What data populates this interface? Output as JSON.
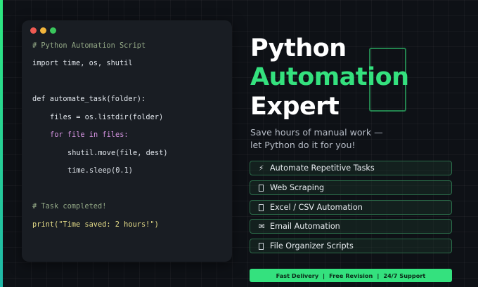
{
  "colors": {
    "accent_green": "#34e17e",
    "background": "#0e1116",
    "code_panel": "#191d23",
    "dot_red": "#ee5a52",
    "dot_yellow": "#f2b53c",
    "dot_green": "#3ac65c"
  },
  "code": {
    "lines": [
      "# Python Automation Script",
      "import time, os, shutil",
      "def automate_task(folder):",
      "files = os.listdir(folder)",
      "for file in files:",
      "shutil.move(file, dest)",
      "time.sleep(0.1)",
      "# Task completed!",
      "print(\"Time saved: 2 hours!\")"
    ]
  },
  "hero": {
    "title_line1": "Python",
    "title_line2": "Automation",
    "title_line3": "Expert",
    "subtitle_line1": "Save hours of manual work —",
    "subtitle_line2": "let Python do it for you!"
  },
  "features": [
    {
      "icon": "lightning-icon",
      "glyph": "⚡",
      "label": "Automate Repetitive Tasks"
    },
    {
      "icon": "web-icon",
      "glyph": "",
      "label": "Web Scraping"
    },
    {
      "icon": "spreadsheet-icon",
      "glyph": "",
      "label": "Excel / CSV Automation"
    },
    {
      "icon": "envelope-icon",
      "glyph": "✉",
      "label": "Email Automation"
    },
    {
      "icon": "folder-icon",
      "glyph": "",
      "label": "File Organizer Scripts"
    }
  ],
  "banner": {
    "item1": "Fast Delivery",
    "item2": "Free Revision",
    "item3": "24/7 Support",
    "separator": "|"
  }
}
